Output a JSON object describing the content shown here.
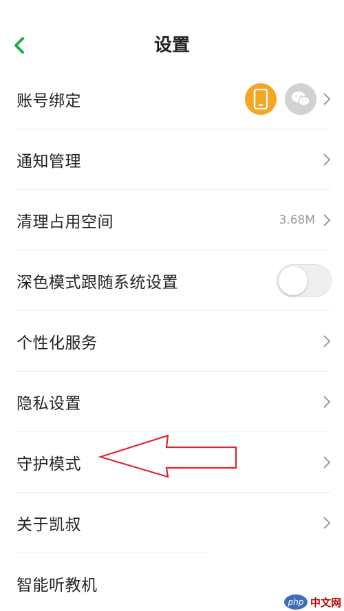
{
  "header": {
    "title": "设置",
    "accent_color": "#1fa94b"
  },
  "rows": [
    {
      "label": "账号绑定"
    },
    {
      "label": "通知管理"
    },
    {
      "label": "清理占用空间",
      "value": "3.68M"
    },
    {
      "label": "深色模式跟随系统设置",
      "toggle_on": false
    },
    {
      "label": "个性化服务"
    },
    {
      "label": "隐私设置"
    },
    {
      "label": "守护模式"
    },
    {
      "label": "关于凯叔"
    },
    {
      "label": "智能听教机"
    }
  ],
  "bind_icons": [
    "phone-icon",
    "wechat-icon"
  ],
  "bind_colors": {
    "phone": "#f5a623",
    "wechat": "#d2d2d2"
  },
  "annotation": {
    "arrow_color": "#e0262b",
    "points_to": "守护模式"
  },
  "watermark": {
    "logo": "php",
    "text": "中文网"
  }
}
